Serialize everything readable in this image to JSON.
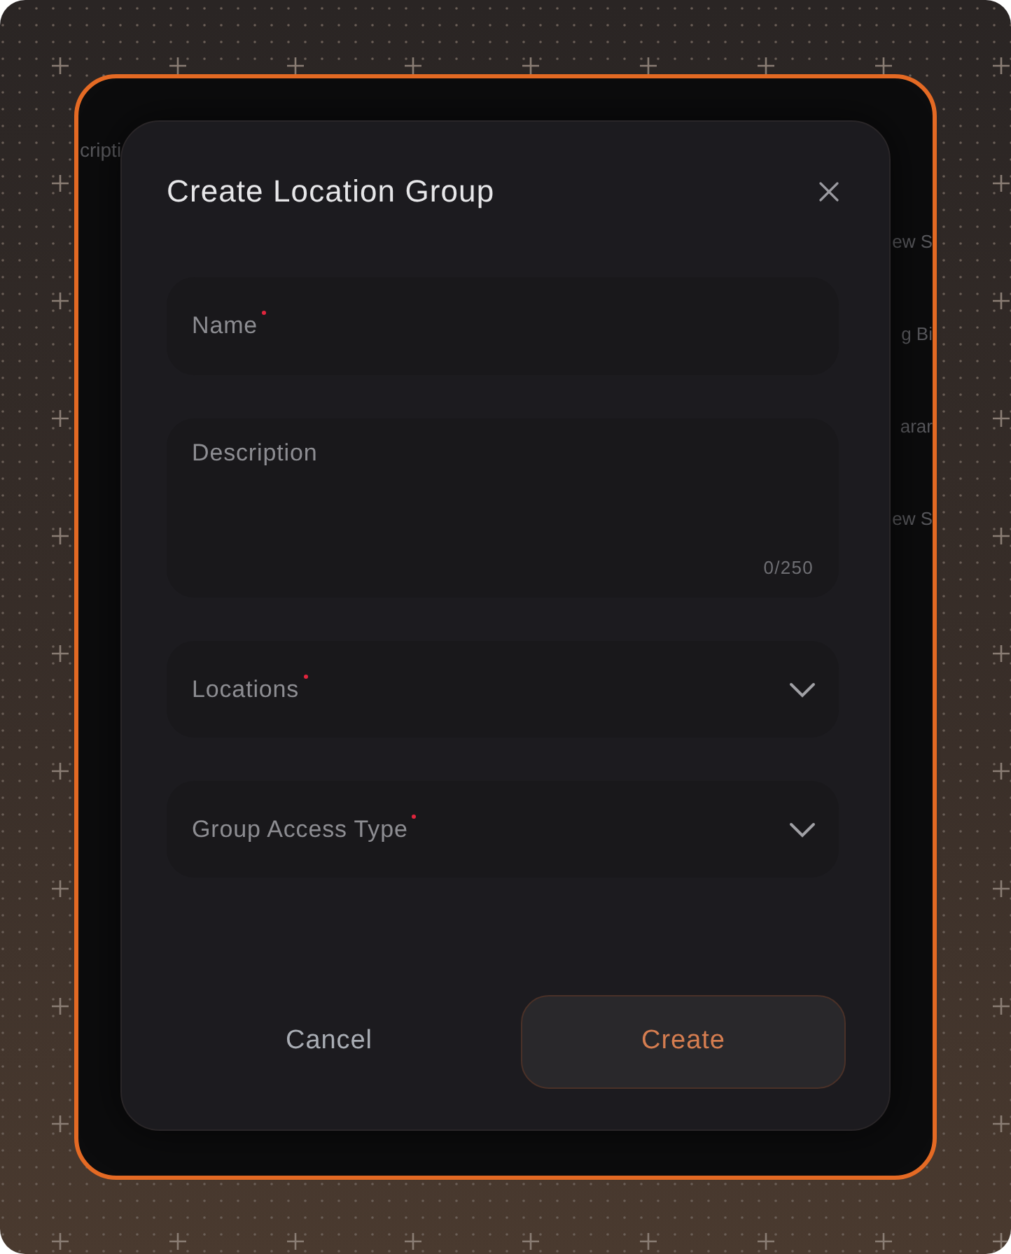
{
  "background_rows": [
    {
      "left": "cripti",
      "right": ""
    },
    {
      "left": "",
      "right": "ew S"
    },
    {
      "left": "",
      "right": "g Bi"
    },
    {
      "left": "",
      "right": "arar"
    },
    {
      "left": "",
      "right": "ew S"
    }
  ],
  "dialog": {
    "title": "Create Location Group",
    "fields": [
      {
        "kind": "text",
        "placeholder": "Name",
        "required": true
      },
      {
        "kind": "textarea",
        "placeholder": "Description",
        "required": false,
        "counter": "0/250"
      },
      {
        "kind": "select",
        "placeholder": "Locations",
        "required": true
      },
      {
        "kind": "select",
        "placeholder": "Group Access Type",
        "required": true
      }
    ],
    "buttons": [
      {
        "label": "Cancel",
        "kind": "text"
      },
      {
        "label": "Create",
        "kind": "primary"
      }
    ]
  }
}
